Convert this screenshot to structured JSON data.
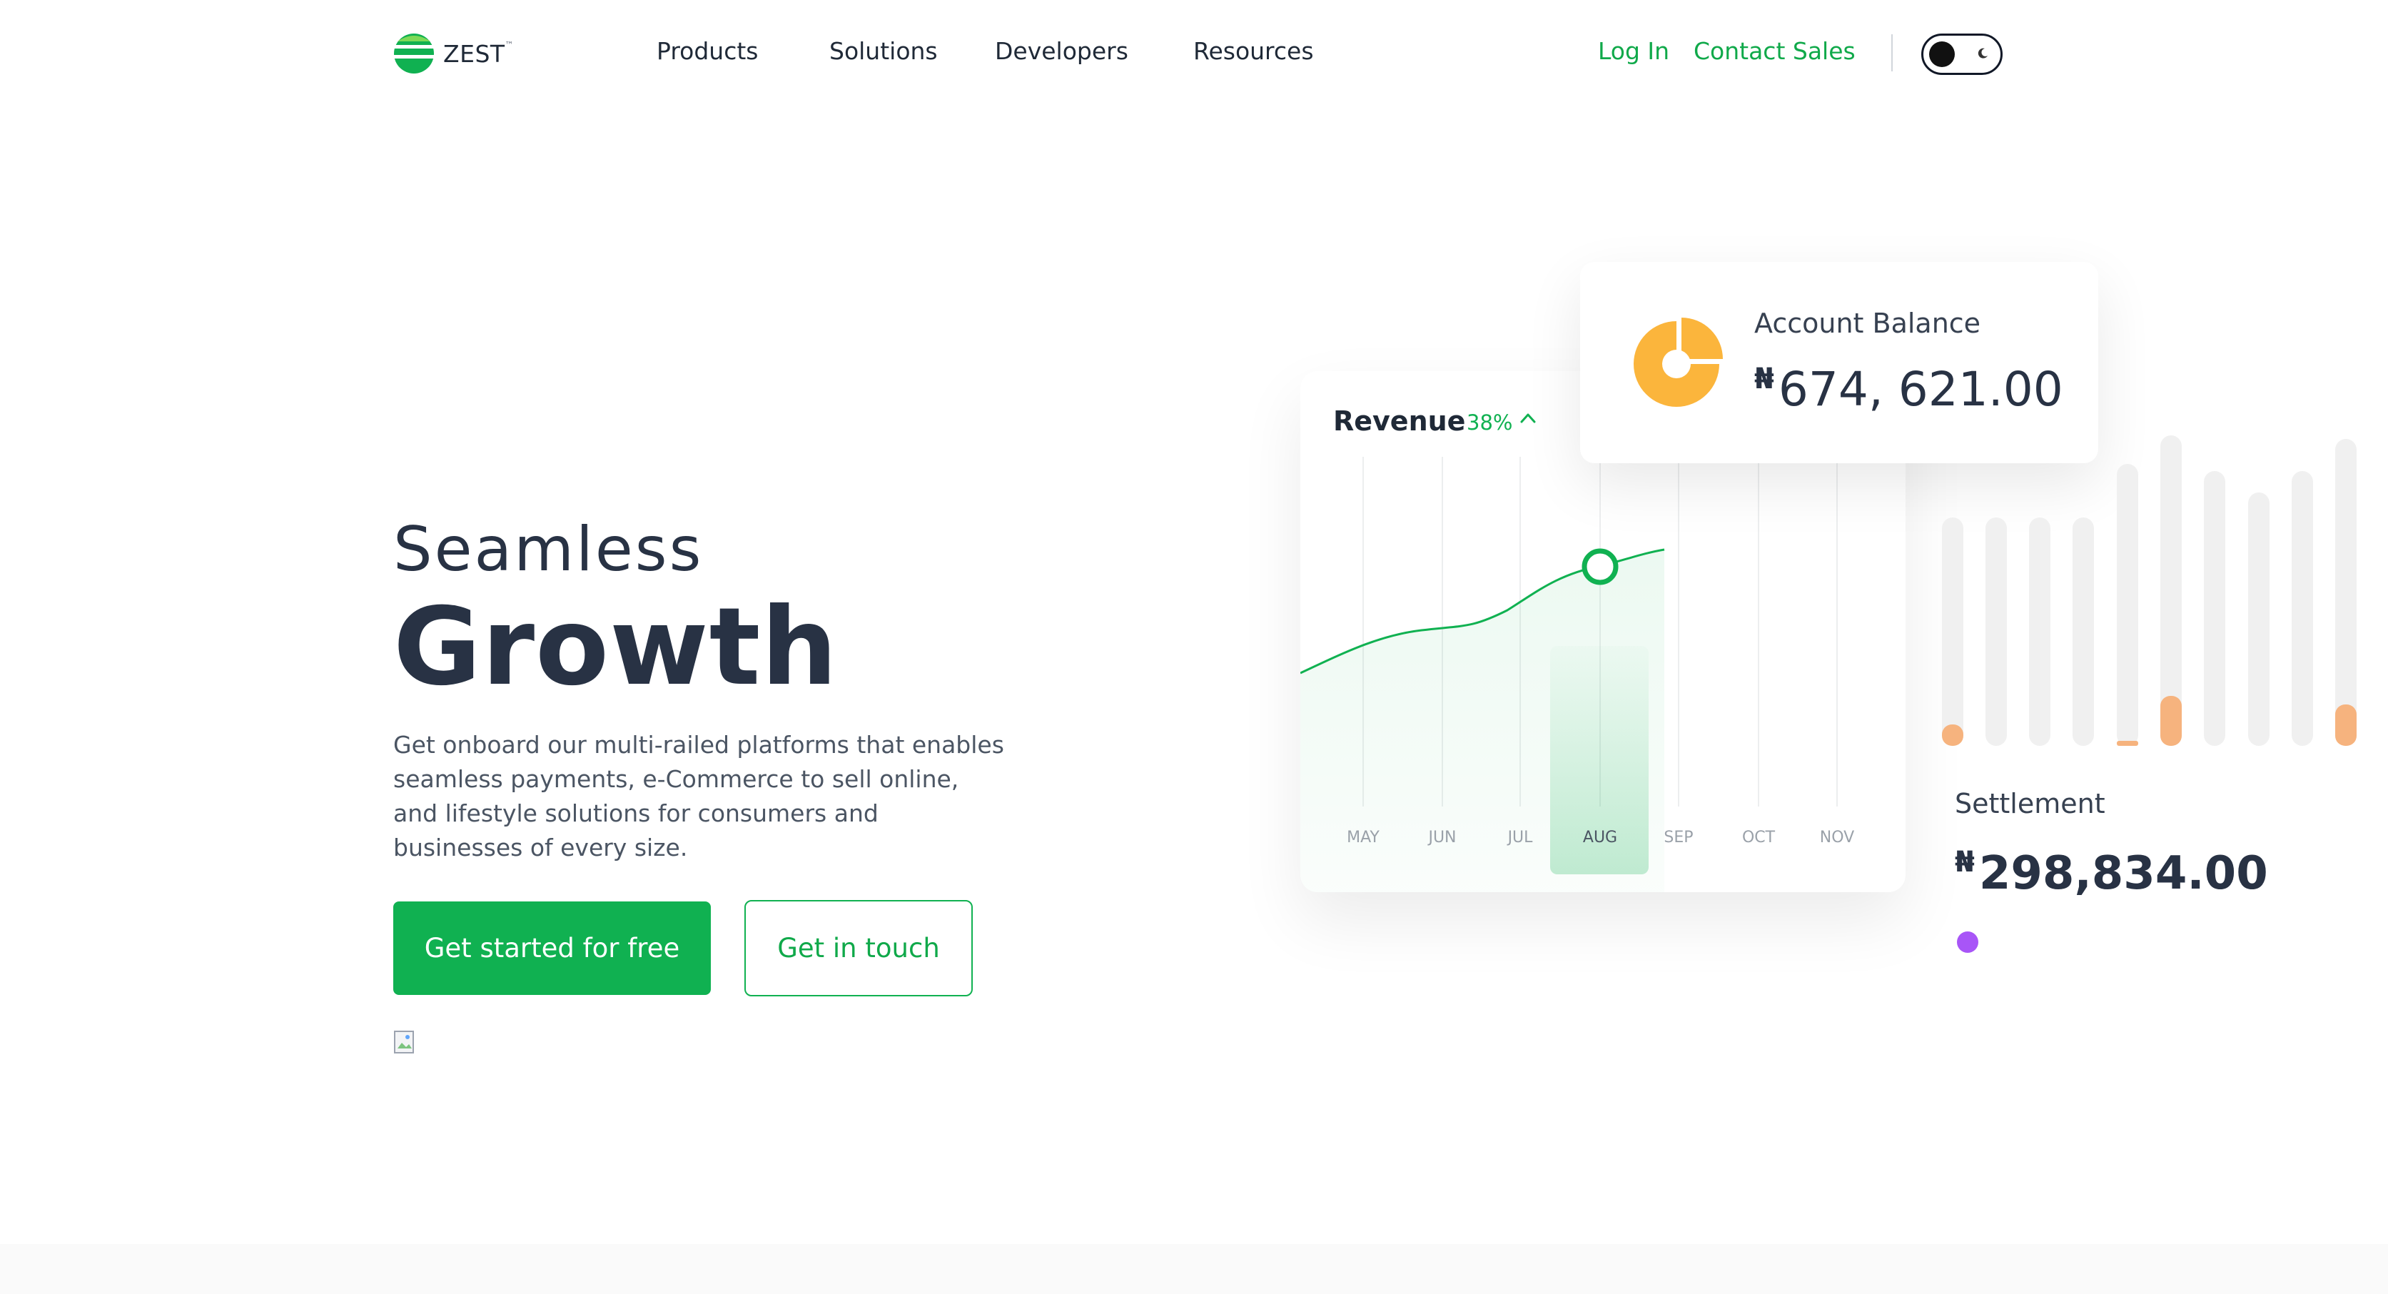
{
  "brand": {
    "name": "ZEST",
    "mark": "™"
  },
  "nav": {
    "items": [
      {
        "label": "Products"
      },
      {
        "label": "Solutions"
      },
      {
        "label": "Developers"
      },
      {
        "label": "Resources"
      }
    ],
    "login": "Log In",
    "contact": "Contact Sales",
    "theme_toggle": "dark-mode-toggle"
  },
  "hero": {
    "pre_title": "Seamless",
    "title": "Growth",
    "description": "Get onboard our multi-railed platforms that enables seamless payments, e-Commerce to sell online, and lifestyle solutions for consumers and businesses of every size.",
    "primary_cta": "Get started for free",
    "secondary_cta": "Get in touch"
  },
  "revenue": {
    "title": "Revenue",
    "change": "38%",
    "months": [
      "MAY",
      "JUN",
      "JUL",
      "AUG",
      "SEP",
      "OCT",
      "NOV"
    ],
    "active_month": "AUG"
  },
  "balance": {
    "label": "Account Balance",
    "currency": "₦",
    "value": "674, 621.00"
  },
  "settlement": {
    "label": "Settlement",
    "currency": "₦",
    "value": "298,834.00"
  },
  "colors": {
    "primary": "#10b151",
    "text_dark": "#283244",
    "accent_orange": "#fbb53c",
    "bar_orange": "#f6b37e",
    "dot_purple": "#a855f7"
  },
  "chart_data": {
    "type": "line",
    "x": [
      "MAY",
      "JUN",
      "JUL",
      "AUG",
      "SEP",
      "OCT",
      "NOV"
    ],
    "highlighted": "AUG"
  }
}
